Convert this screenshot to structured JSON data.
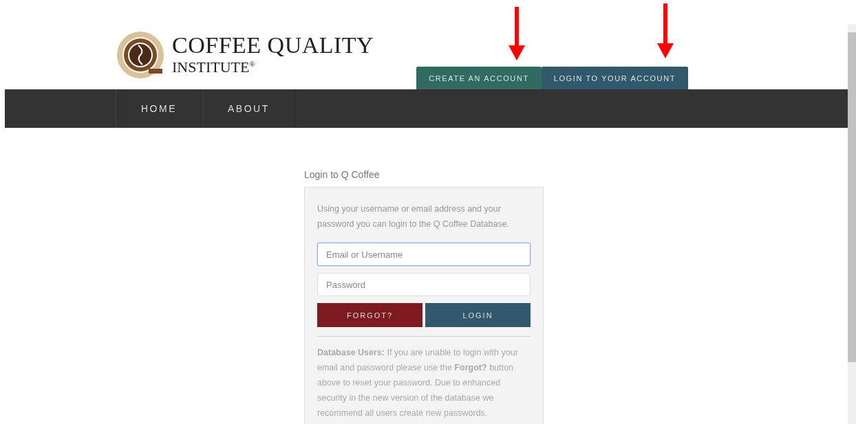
{
  "logo": {
    "line_1": "COFFEE QUALITY",
    "line_2": "INSTITUTE$^{®}$"
  },
  "account_tabs": [
    {
      "label": "CREATE AN ACCOUNT",
      "color": "#316b60"
    },
    {
      "label": "LOGIN TO YOUR ACCOUNT",
      "color": "#32586b"
    }
  ],
  "nav": {
    "items": [
      "HOME",
      "ABOUT"
    ]
  },
  "login": {
    "heading": "Login to Q Coffee",
    "intro": "Using your username or email address and your password you can login to the Q Coffee Database.",
    "fields": [
      {
        "placeholder": "Email or Username",
        "focused": true
      },
      {
        "placeholder": "Password",
        "focused": false
      }
    ],
    "buttons": [
      {
        "label": "FORGOT?",
        "kind": "secondary"
      },
      {
        "label": "LOGIN",
        "kind": "primary"
      }
    ],
    "note": "**Database Users:** If you are unable to login with your email and password please use the **Forgot?** button above to reset your password. Due to enhanced security in the new version of the database we recommend all users create new passwords."
  }
}
